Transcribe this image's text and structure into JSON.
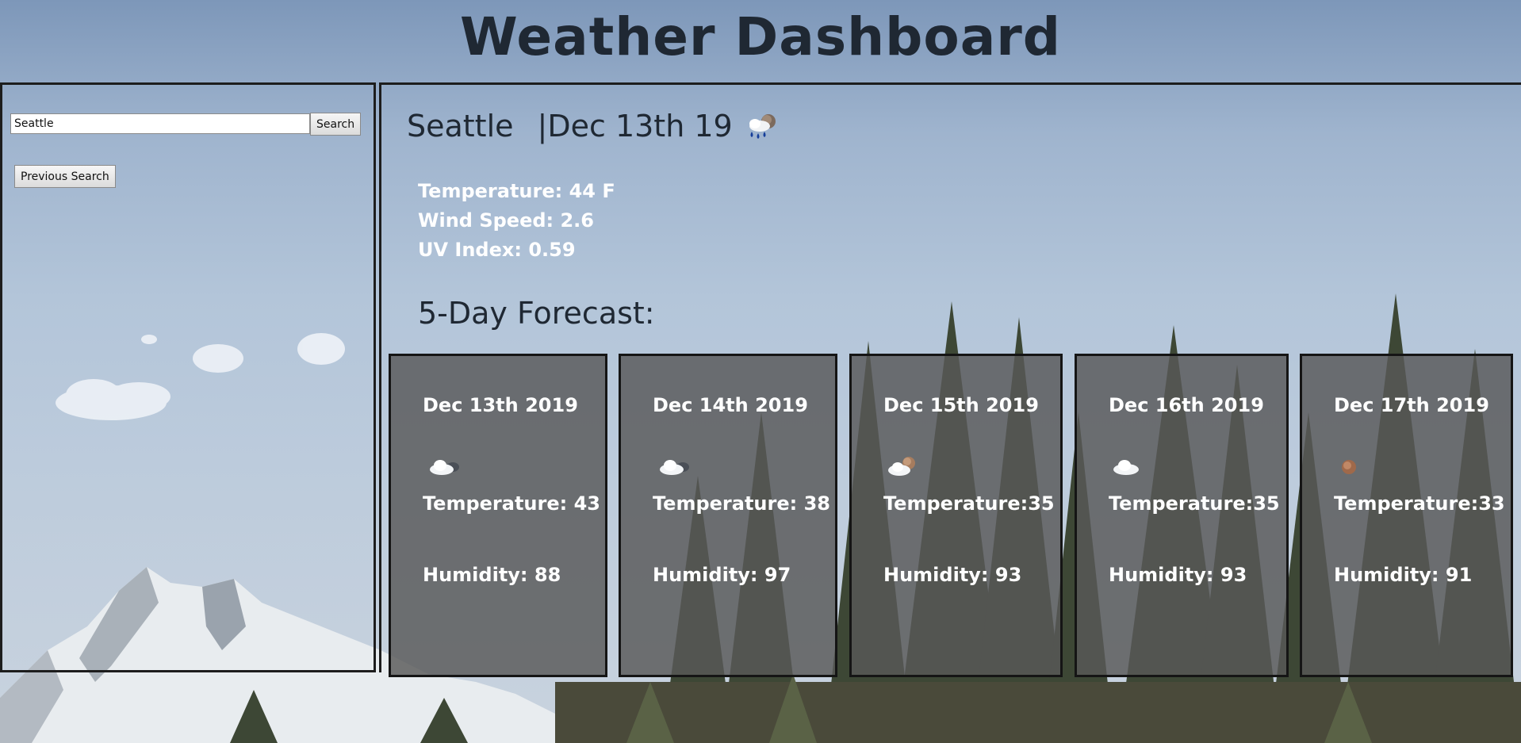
{
  "header": {
    "title": "Weather Dashboard"
  },
  "sidebar": {
    "search_value": "Seattle",
    "search_button": "Search",
    "previous_search_button": "Previous Search"
  },
  "current": {
    "city": "Seattle",
    "date": "|Dec 13th 19",
    "icon": "rain-clouds-icon",
    "temperature": "Temperature: 44 F",
    "wind_speed": "Wind Speed: 2.6",
    "uv_index": "UV Index: 0.59"
  },
  "forecast": {
    "title": "5-Day Forecast:",
    "days": [
      {
        "date": "Dec 13th 2019",
        "icon": "cloud-icon",
        "temperature": "Temperature: 43",
        "humidity": "Humidity: 88"
      },
      {
        "date": "Dec 14th 2019",
        "icon": "cloud-icon",
        "temperature": "Temperature: 38",
        "humidity": "Humidity: 97"
      },
      {
        "date": "Dec 15th 2019",
        "icon": "cloud-moon-icon",
        "temperature": "Temperature:35",
        "humidity": "Humidity: 93"
      },
      {
        "date": "Dec 16th 2019",
        "icon": "cloud-icon",
        "temperature": "Temperature:35",
        "humidity": "Humidity: 93"
      },
      {
        "date": "Dec 17th 2019",
        "icon": "moon-icon",
        "temperature": "Temperature:33",
        "humidity": "Humidity: 91"
      }
    ]
  },
  "colors": {
    "card_background": "#585858",
    "border": "#1d1d1d",
    "heading_text": "#1f2833",
    "stat_text": "#ffffff"
  }
}
